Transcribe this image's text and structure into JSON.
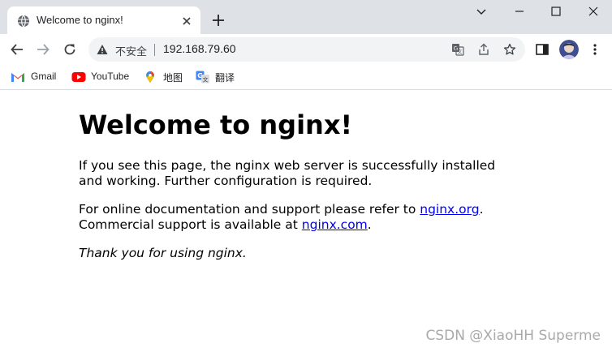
{
  "window": {
    "controls": [
      "chevron-down",
      "minimize",
      "maximize",
      "close"
    ]
  },
  "tab": {
    "title": "Welcome to nginx!",
    "favicon": "globe-icon"
  },
  "toolbar": {
    "security_label": "不安全",
    "url": "192.168.79.60"
  },
  "bookmarks": [
    {
      "label": "Gmail",
      "icon": "gmail-icon"
    },
    {
      "label": "YouTube",
      "icon": "youtube-icon"
    },
    {
      "label": "地图",
      "icon": "maps-icon"
    },
    {
      "label": "翻译",
      "icon": "translate-icon"
    }
  ],
  "page": {
    "heading": "Welcome to nginx!",
    "para1": "If you see this page, the nginx web server is successfully installed and working. Further configuration is required.",
    "para2_text1": "For online documentation and support please refer to ",
    "para2_link1": "nginx.org",
    "para2_text2": ".",
    "para2_text3": "Commercial support is available at ",
    "para2_link2": "nginx.com",
    "para2_text4": ".",
    "thanks": "Thank you for using nginx."
  },
  "watermark": "CSDN @XiaoHH Superme",
  "colors": {
    "tabstrip": "#dee1e6",
    "omnibox": "#f1f3f4",
    "link": "#0000ee",
    "youtube_red": "#ff0000",
    "gmail_red": "#ea4335"
  }
}
